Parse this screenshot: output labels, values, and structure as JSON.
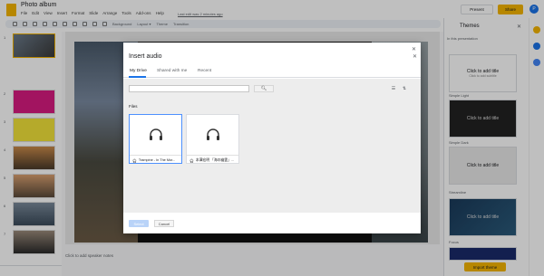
{
  "app": {
    "title": "Photo album",
    "menu": [
      "File",
      "Edit",
      "View",
      "Insert",
      "Format",
      "Slide",
      "Arrange",
      "Tools",
      "Add-ons",
      "Help"
    ],
    "last_edit": "Last edit was 2 minutes ago",
    "present_label": "Present",
    "share_label": "Share",
    "avatar_letter": "P",
    "toolbar": {
      "background": "Background",
      "layout": "Layout ▾",
      "theme": "Theme",
      "transition": "Transition"
    }
  },
  "speaker_notes": "Click to add speaker notes",
  "themes_panel": {
    "title": "Themes",
    "subtitle": "In this presentation",
    "card_text": "Click to add title",
    "card_subtext": "Click to add subtitle",
    "themes": [
      {
        "name": "Simple Light"
      },
      {
        "name": "Simple Dark"
      },
      {
        "name": "Streamline"
      },
      {
        "name": "Focus"
      }
    ],
    "import_label": "Import theme"
  },
  "dialog": {
    "title": "Insert audio",
    "tabs": [
      "My Drive",
      "Shared with me",
      "Recent"
    ],
    "active_tab": "My Drive",
    "search_placeholder": "",
    "files_label": "Files",
    "files": [
      {
        "name": "Trampine - In The Mor...",
        "selected": true
      },
      {
        "name": "本澤宏明 「海の幽霊」...",
        "selected": false
      }
    ],
    "select_label": "Select",
    "cancel_label": "Cancel"
  },
  "colors": {
    "accent": "#f4b400",
    "link_blue": "#1a73e8"
  }
}
